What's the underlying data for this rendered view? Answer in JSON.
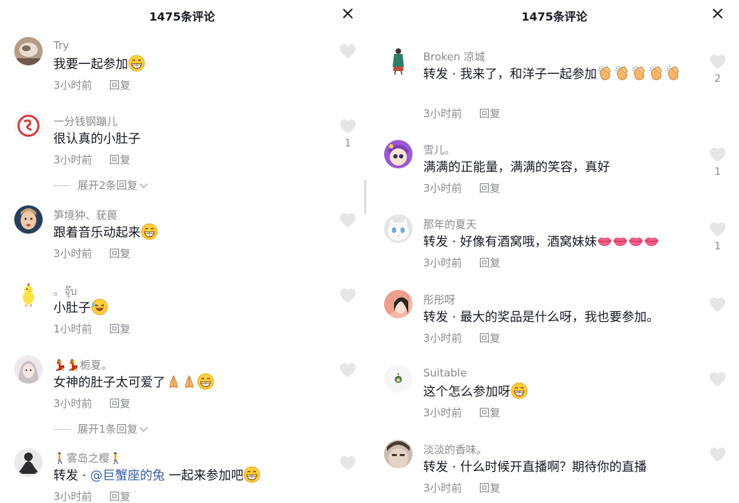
{
  "left": {
    "title": "1475条评论",
    "comments": [
      {
        "user": "Try",
        "text": "我要一起参加",
        "time": "3小时前",
        "reply": "回复",
        "likes": ""
      },
      {
        "user": "一分钱钢蹦儿",
        "text": "很认真的小肚子",
        "time": "3小时前",
        "reply": "回复",
        "likes": "1",
        "expand": "展开2条回复"
      },
      {
        "user": "笋境狆、莸葨",
        "text": "跟着音乐动起来",
        "time": "3小时前",
        "reply": "回复",
        "likes": ""
      },
      {
        "user": "。จุ๊บ",
        "text": "小肚子",
        "time": "1小时前",
        "reply": "回复",
        "likes": ""
      },
      {
        "user": "栀夏。",
        "text": "女神的肚子太可爱了",
        "time": "3小时前",
        "reply": "回复",
        "likes": "",
        "expand": "展开1条回复"
      },
      {
        "user": "雾岛之樱",
        "text_prefix": "转发 · ",
        "mention": "@巨蟹座的兔",
        "text_suffix": " 一起来参加吧",
        "time": "3小时前",
        "reply": "回复",
        "likes": ""
      }
    ]
  },
  "right": {
    "title": "1475条评论",
    "comments": [
      {
        "user": "Broken 凉城",
        "text": "转发 · 我来了，和洋子一起参加",
        "time": "3小时前",
        "reply": "回复",
        "likes": "2"
      },
      {
        "user": "雪儿。",
        "text": "满满的正能量，满满的笑容，真好",
        "time": "3小时前",
        "reply": "回复",
        "likes": "1"
      },
      {
        "user": "那年的夏天",
        "text": "转发 · 好像有酒窝哦，酒窝妹妹",
        "time": "3小时前",
        "reply": "回复",
        "likes": "1"
      },
      {
        "user": "彤彤呀",
        "text": "转发 · 最大的奖品是什么呀，我也要参加。",
        "time": "3小时前",
        "reply": "回复",
        "likes": ""
      },
      {
        "user": "Suitable",
        "text": "这个怎么参加呀",
        "time": "3小时前",
        "reply": "回复",
        "likes": ""
      },
      {
        "user": "淡淡的香味。",
        "text": "转发 · 什么时候开直播啊？期待你的直播",
        "time": "3小时前",
        "reply": "回复",
        "likes": ""
      }
    ]
  },
  "colors": {
    "text": "#161823",
    "secondary": "#8a8b91",
    "mention": "#395da1",
    "heart": "#e6e6e8"
  },
  "icons": [
    "close-icon",
    "heart-icon",
    "grin-emoji",
    "laugh-emoji",
    "clap-emoji",
    "pray-emoji",
    "lips-emoji",
    "chevron-down-icon"
  ]
}
